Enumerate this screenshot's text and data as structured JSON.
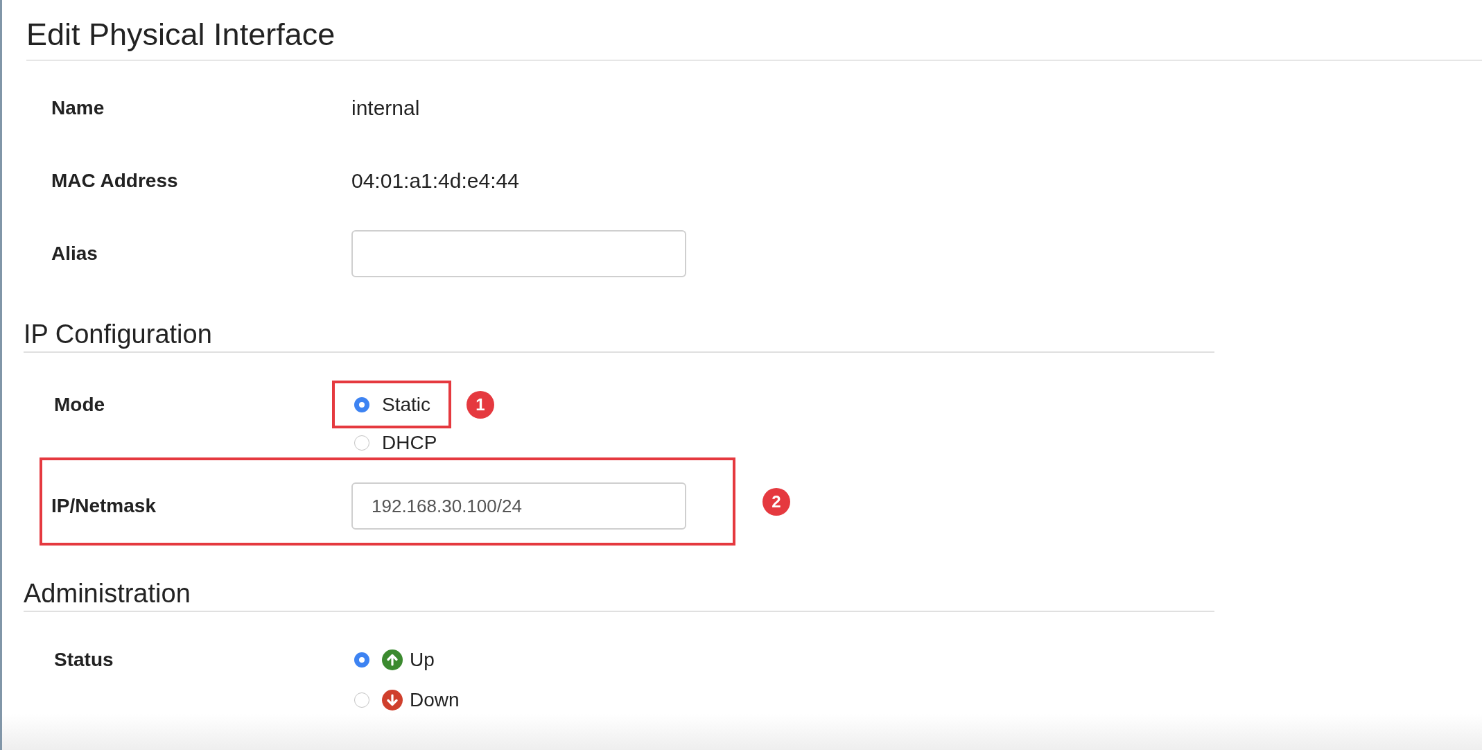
{
  "title": "Edit Physical Interface",
  "fields": [
    {
      "label": "Name",
      "kind": "text",
      "value": "internal"
    },
    {
      "label": "MAC Address",
      "kind": "text",
      "value": "04:01:a1:4d:e4:44"
    },
    {
      "label": "Alias",
      "kind": "input"
    }
  ],
  "sections": [
    {
      "title": "IP Configuration",
      "fields": [
        {
          "label": "Mode",
          "kind": "radio",
          "options": [
            {
              "label": "Static",
              "kind": "plain",
              "selected": true,
              "highlighted": true,
              "callout": "1"
            },
            {
              "label": "DHCP",
              "kind": "plain",
              "selected": false,
              "highlighted": false
            }
          ]
        },
        {
          "label": "IP/Netmask",
          "kind": "input",
          "value": "192.168.30.100/24",
          "highlighted": true,
          "callout": "2"
        }
      ]
    },
    {
      "title": "Administration",
      "fields": [
        {
          "label": "Status",
          "kind": "radio",
          "options": [
            {
              "label": "Up",
              "kind": "up",
              "selected": true,
              "highlighted": false
            },
            {
              "label": "Down",
              "kind": "down",
              "selected": false,
              "highlighted": false
            }
          ]
        }
      ]
    }
  ]
}
